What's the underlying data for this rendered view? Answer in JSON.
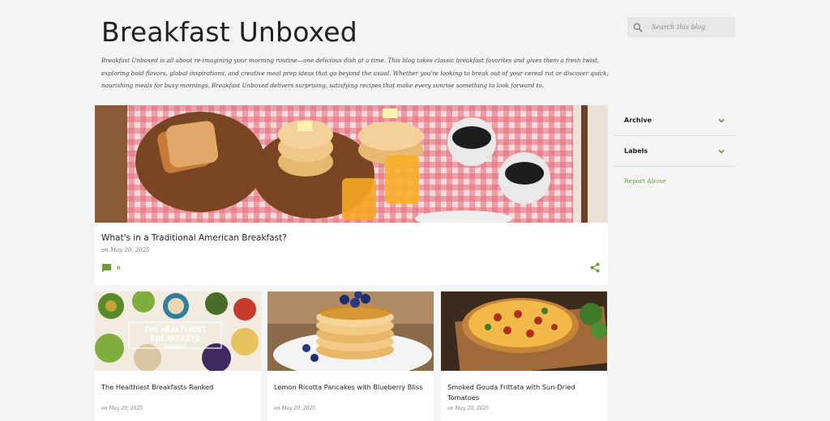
{
  "blog": {
    "title": "Breakfast Unboxed",
    "description": "Breakfast Unboxed is all about re-imagining your morning routine—one delicious dish at a time. This blog takes classic breakfast favorites and gives them a fresh twist, exploring bold flavors, global inspirations, and creative meal prep ideas that go beyond the usual. Whether you're looking to break out of your cereal rut or discover quick, nourishing meals for busy mornings, Breakfast Unboxed delivers surprising, satisfying recipes that make every sunrise something to look forward to."
  },
  "search": {
    "placeholder": "Search this blog",
    "icon": "search-icon"
  },
  "sidebar": {
    "items": [
      {
        "label": "Archive",
        "icon": "chevron-down-icon"
      },
      {
        "label": "Labels",
        "icon": "chevron-down-icon"
      }
    ],
    "report_abuse": "Report Abuse"
  },
  "featured": {
    "title": "What's in a Traditional American Breakfast?",
    "date": "on May 20, 2025",
    "comments": "0"
  },
  "posts": [
    {
      "title": "The Healthiest Breakfasts Ranked",
      "date": "on May 20, 2025",
      "image_text": [
        "THE HEALTHIEST",
        "BREAKFASTS",
        "RANKED"
      ]
    },
    {
      "title": "Lemon Ricotta Pancakes with Blueberry Bliss",
      "date": "on May 20, 2025"
    },
    {
      "title": "Smoked Gouda Frittata with Sun-Dried Tomatoes",
      "date": "on May 20, 2025"
    }
  ],
  "colors": {
    "accent": "#689f38",
    "background": "#f4f4f4",
    "text": "#212121"
  }
}
